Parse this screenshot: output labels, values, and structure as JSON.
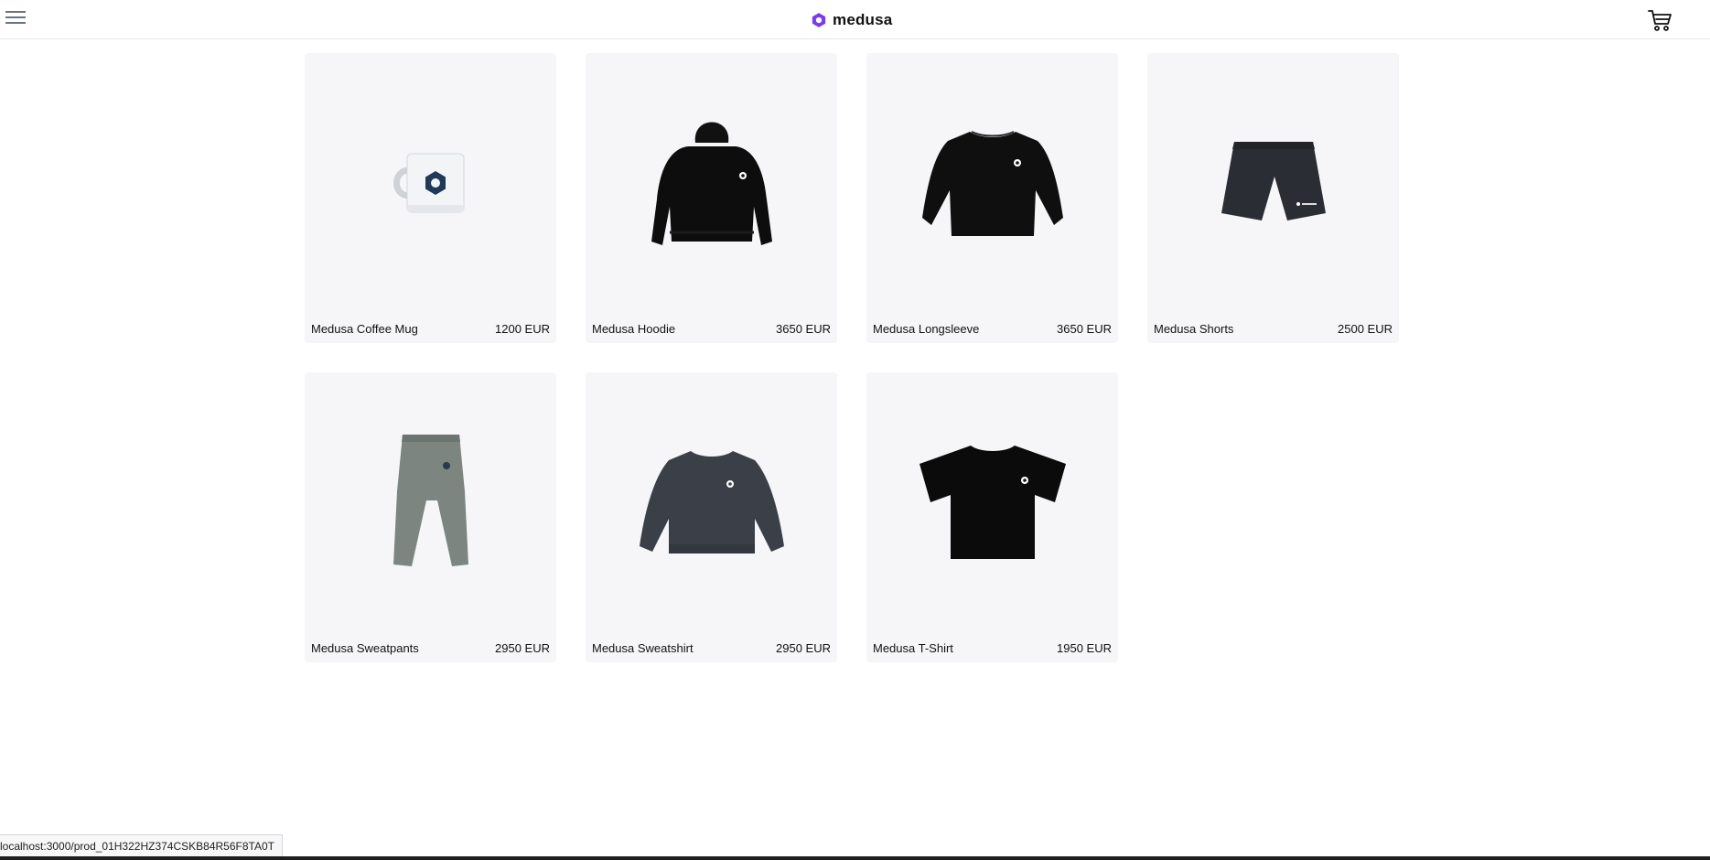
{
  "header": {
    "brand": "medusa",
    "colors": {
      "brand_purple": "#7c3aed",
      "border": "#e5e7eb"
    }
  },
  "products": [
    {
      "name": "Medusa Coffee Mug",
      "price": "1200 EUR",
      "icon": "mug"
    },
    {
      "name": "Medusa Hoodie",
      "price": "3650 EUR",
      "icon": "hoodie"
    },
    {
      "name": "Medusa Longsleeve",
      "price": "3650 EUR",
      "icon": "longsleeve"
    },
    {
      "name": "Medusa Shorts",
      "price": "2500 EUR",
      "icon": "shorts"
    },
    {
      "name": "Medusa Sweatpants",
      "price": "2950 EUR",
      "icon": "sweatpants"
    },
    {
      "name": "Medusa Sweatshirt",
      "price": "2950 EUR",
      "icon": "sweatshirt"
    },
    {
      "name": "Medusa T-Shirt",
      "price": "1950 EUR",
      "icon": "tshirt"
    }
  ],
  "status_bar": {
    "url": "localhost:3000/prod_01H322HZ374CSKB84R56F8TA0T"
  }
}
